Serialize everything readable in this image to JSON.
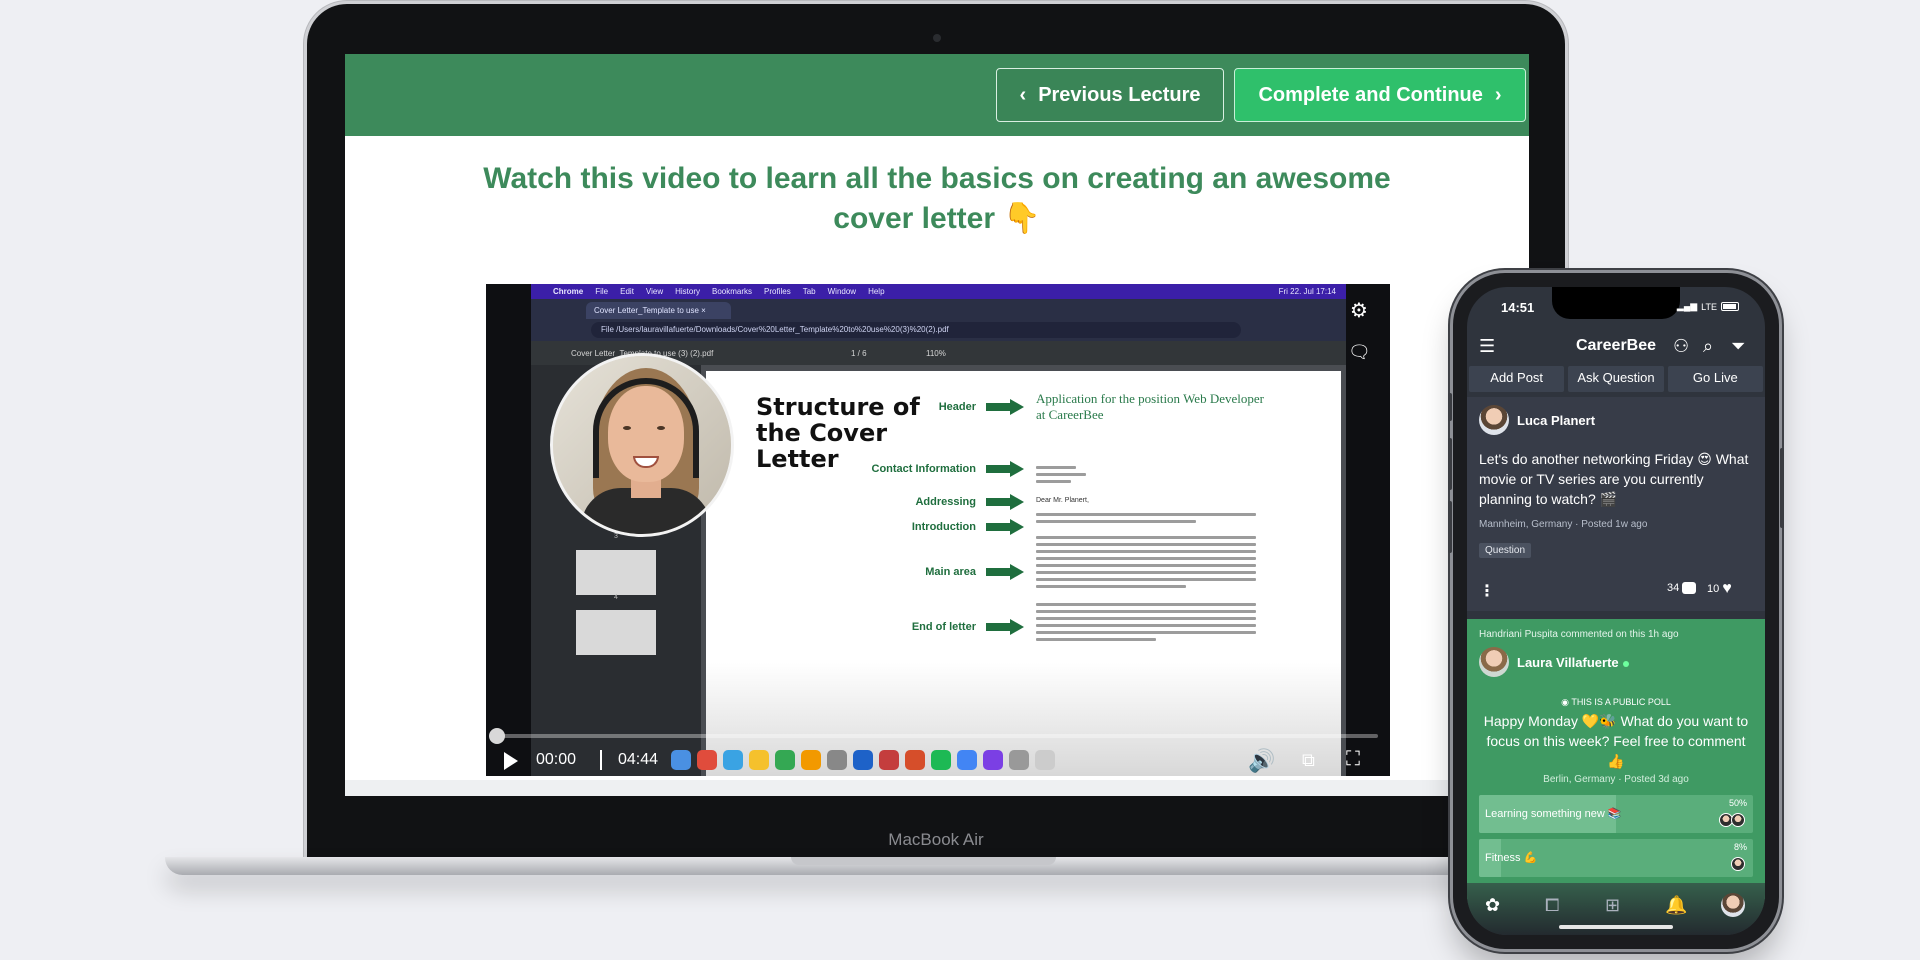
{
  "laptop": {
    "model_label": "MacBook Air",
    "lecture_nav": {
      "previous_label": "Previous Lecture",
      "next_label": "Complete and Continue"
    },
    "heading": "Watch this video to learn all the basics on creating an awesome cover letter 👇",
    "video": {
      "mac_menu": [
        "Chrome",
        "File",
        "Edit",
        "View",
        "History",
        "Bookmarks",
        "Profiles",
        "Tab",
        "Window",
        "Help"
      ],
      "mac_clock": "Fri 22. Jul 17:14",
      "browser_tab": "Cover Letter_Template to use ×",
      "address": "File  /Users/lauravillafuerte/Downloads/Cover%20Letter_Template%20to%20use%20(3)%20(2).pdf",
      "pdf_title": "Cover Letter_Template to use (3) (2).pdf",
      "pdf_page": "1 / 6",
      "pdf_zoom": "110%",
      "doc_title": "Structure of the Cover Letter",
      "sections": [
        "Header",
        "Contact Information",
        "Addressing",
        "Introduction",
        "Main area",
        "End of letter"
      ],
      "application_text": "Application for the position Web Developer at CareerBee",
      "salutation": "Dear Mr. Planert,",
      "thumb_numbers": [
        "3",
        "4"
      ],
      "elapsed": "00:00",
      "duration": "04:44",
      "progress_fraction": 0.0
    }
  },
  "phone": {
    "status_time": "14:51",
    "network": "LTE",
    "app_title": "CareerBee",
    "actions": [
      "Add Post",
      "Ask Question",
      "Go Live"
    ],
    "post": {
      "author": "Luca Planert",
      "text": "Let's do another networking Friday 😍 What movie or TV series are you currently planning to watch? 🎬",
      "meta": "Mannheim, Germany · Posted 1w ago",
      "tag": "Question",
      "comments": "34",
      "likes": "10"
    },
    "poll": {
      "activity": "Handriani Puspita commented on this 1h ago",
      "author": "Laura Villafuerte",
      "public_label": "THIS IS A PUBLIC POLL",
      "question": "Happy Monday 💛🐝 What do you want to focus on this week? Feel free to comment 👍",
      "meta": "Berlin, Germany · Posted 3d ago",
      "options": [
        {
          "label": "Learning something new 📚",
          "percent": "50%",
          "fraction": 0.5
        },
        {
          "label": "Fitness 💪",
          "percent": "8%",
          "fraction": 0.08
        }
      ]
    },
    "tab_icons": [
      "home-icon",
      "chat-icon",
      "add-icon",
      "bell-icon",
      "profile-icon"
    ]
  }
}
